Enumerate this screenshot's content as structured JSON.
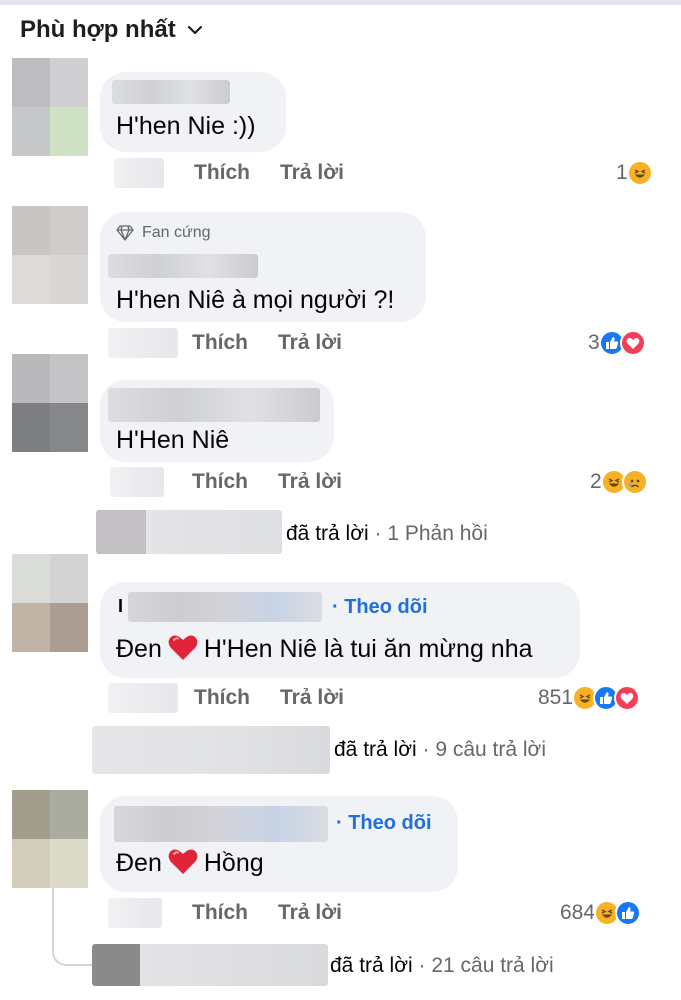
{
  "sort": {
    "label": "Phù hợp nhất",
    "icon": "chevron-down-icon"
  },
  "actions": {
    "like": "Thích",
    "reply": "Trả lời"
  },
  "comments": [
    {
      "text": "H'hen Nie :))",
      "reactions": {
        "count": "1",
        "icons": [
          "haha"
        ]
      }
    },
    {
      "badge": "Fan cứng",
      "text": "H'hen Niê à mọi người ?!",
      "reactions": {
        "count": "3",
        "icons": [
          "like",
          "love"
        ]
      }
    },
    {
      "text": "H'Hen Niê",
      "reactions": {
        "count": "2",
        "icons": [
          "haha",
          "sad"
        ]
      },
      "replies": {
        "verb": "đã trả lời",
        "sep": "·",
        "summary": "1 Phản hồi"
      }
    },
    {
      "name_initial": "I",
      "follow": "· Theo dõi",
      "text_before": "Đen",
      "text_after": "H'Hen Niê là tui ăn mừng nha",
      "reactions": {
        "count": "851",
        "icons": [
          "haha",
          "like",
          "love"
        ]
      },
      "replies": {
        "verb": "đã trả lời",
        "sep": "·",
        "summary": "9 câu trả lời"
      }
    },
    {
      "follow": "· Theo dõi",
      "text_before": "Đen",
      "text_after": "Hồng",
      "reactions": {
        "count": "684",
        "icons": [
          "haha",
          "like"
        ]
      },
      "replies": {
        "verb": "đã trả lời",
        "sep": "·",
        "summary": "21 câu trả lời"
      }
    }
  ],
  "colors": {
    "follow": "#216fdb",
    "like": "#1877f2",
    "love": "#f33e58",
    "haha": "#f7b125",
    "muted": "#65676b",
    "bubble": "#f0f2f5"
  }
}
